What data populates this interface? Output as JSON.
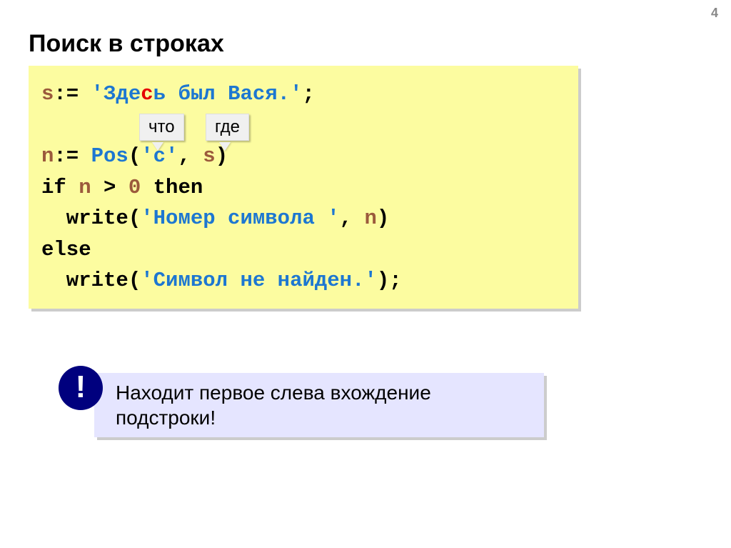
{
  "pageNumber": "4",
  "title": "Поиск в строках",
  "code": {
    "line1": {
      "a": "s",
      "b": ":= ",
      "c": "'Зде",
      "d": "с",
      "e": "ь был Вася.'",
      "f": ";"
    },
    "line2_blank": " ",
    "line3": {
      "a": "n",
      "b": ":= ",
      "c": "Pos",
      "d": "(",
      "e": "'с'",
      "f": ", ",
      "g": "s",
      "h": ")"
    },
    "line4": {
      "a": "if ",
      "b": "n",
      "c": " > ",
      "d": "0",
      "e": " then"
    },
    "line5": {
      "a": "  write(",
      "b": "'Номер символа '",
      "c": ", ",
      "d": "n",
      "e": ")"
    },
    "line6": "else",
    "line7": {
      "a": "  write(",
      "b": "'Символ не найден.'",
      "c": ");"
    }
  },
  "callouts": {
    "what": "что",
    "where": "где"
  },
  "note": {
    "bang": "!",
    "line1": " Находит первое слева вхождение",
    "line2": " подстроки!"
  }
}
